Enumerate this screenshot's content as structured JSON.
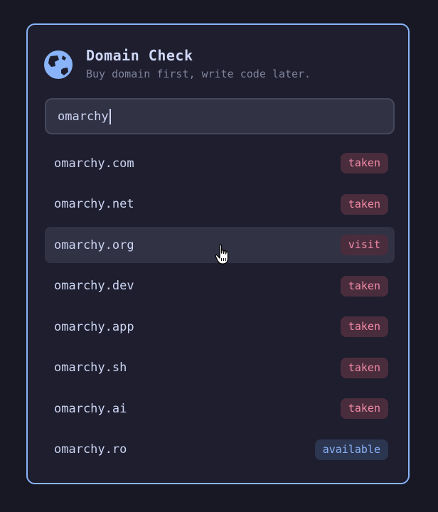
{
  "app": {
    "title": "Domain Check",
    "subtitle": "Buy domain first, write code later.",
    "icon": "globe-icon"
  },
  "search": {
    "value": "omarchy"
  },
  "colors": {
    "accent": "#89b4fa",
    "taken": "#f38ba8",
    "background": "#1e1e2e"
  },
  "results": [
    {
      "domain": "omarchy.com",
      "status": "taken"
    },
    {
      "domain": "omarchy.net",
      "status": "taken"
    },
    {
      "domain": "omarchy.org",
      "status": "visit",
      "hovered": true
    },
    {
      "domain": "omarchy.dev",
      "status": "taken"
    },
    {
      "domain": "omarchy.app",
      "status": "taken"
    },
    {
      "domain": "omarchy.sh",
      "status": "taken"
    },
    {
      "domain": "omarchy.ai",
      "status": "taken"
    },
    {
      "domain": "omarchy.ro",
      "status": "available"
    }
  ]
}
